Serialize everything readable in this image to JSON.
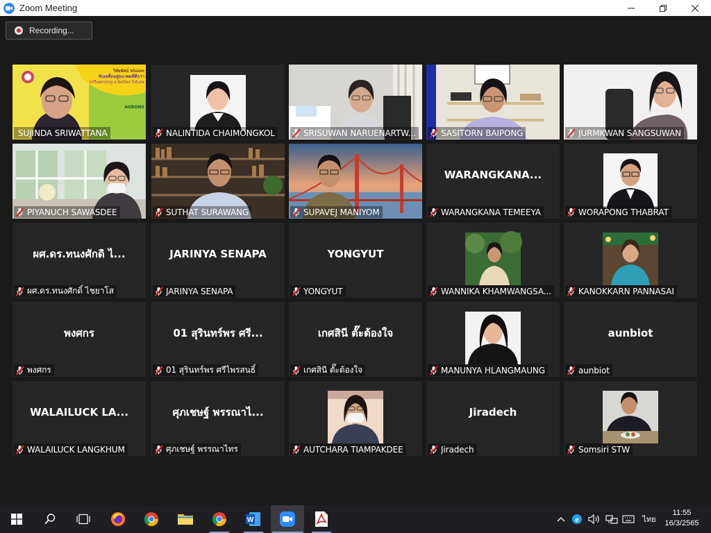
{
  "window": {
    "title": "Zoom Meeting"
  },
  "recording": {
    "label": "Recording..."
  },
  "participants": [
    {
      "name": "SUJINDA SRIWATTANA",
      "video": true,
      "active_speaker": true,
      "muted": false,
      "banner_line1": "วิสัยทัศน์ Vision",
      "banner_line2": "ขับเคลื่อนสู่อนาคตที่ดีกว่า",
      "banner_line3": "Influencing a better future",
      "banner_logo": "AGRONS"
    },
    {
      "name": "NALINTIDA CHAIMONGKOL",
      "video": true,
      "muted": true
    },
    {
      "name": "SRISUWAN NARUENARTW...",
      "video": true,
      "muted": true
    },
    {
      "name": "SASITORN BAIPONG",
      "video": true,
      "muted": true
    },
    {
      "name": "JURMKWAN SANGSUWAN",
      "video": true,
      "muted": true
    },
    {
      "name": "PIYANUCH SAWASDEE",
      "video": true,
      "muted": true
    },
    {
      "name": "SUTHAT SURAWANG",
      "video": true,
      "muted": true
    },
    {
      "name": "SUPAVEJ MANIYOM",
      "video": true,
      "muted": true
    },
    {
      "name": "WARANGKANA TEMEEYA",
      "video": false,
      "big": "WARANGKANA...",
      "muted": true
    },
    {
      "name": "WORAPONG THABRAT",
      "video": true,
      "muted": true
    },
    {
      "name": "ผศ.ดร.ทนงศักดิ์ ไชยาโส",
      "video": false,
      "big": "ผศ.ดร.ทนงศักดิ ไ...",
      "muted": true
    },
    {
      "name": "JARINYA SENAPA",
      "video": false,
      "big": "JARINYA SENAPA",
      "muted": true
    },
    {
      "name": "YONGYUT",
      "video": false,
      "big": "YONGYUT",
      "muted": true
    },
    {
      "name": "WANNIKA KHAMWANGSA...",
      "video": true,
      "muted": true
    },
    {
      "name": "KANOKKARN PANNASAI",
      "video": true,
      "muted": true
    },
    {
      "name": "พงศกร",
      "video": false,
      "big": "พงศกร",
      "muted": true
    },
    {
      "name": "01 สุรินทร์พร ศรีไพรสนธิ์",
      "video": false,
      "big": "01 สุรินทร์พร ศรี...",
      "muted": true
    },
    {
      "name": "เกศสินี ตั๊ะต้องใจ",
      "video": false,
      "big": "เกศสินี ตั๊ะต้องใจ",
      "muted": true
    },
    {
      "name": "MANUNYA HLANGMAUNG",
      "video": true,
      "muted": true
    },
    {
      "name": "aunbiot",
      "video": false,
      "big": "aunbiot",
      "muted": true
    },
    {
      "name": "WALAILUCK LANGKHUM",
      "video": false,
      "big": "WALAILUCK LA...",
      "muted": true
    },
    {
      "name": "ศุภเชษฐ์ พรรณาไทร",
      "video": false,
      "big": "ศุภเชษฐ์ พรรณาไ...",
      "muted": true
    },
    {
      "name": "AUTCHARA TIAMPAKDEE",
      "video": true,
      "muted": true
    },
    {
      "name": "Jiradech",
      "video": false,
      "big": "Jiradech",
      "muted": true
    },
    {
      "name": "Somsiri STW",
      "video": true,
      "muted": true
    }
  ],
  "taskbar": {
    "apps": [
      "start-icon",
      "search-icon",
      "task-view-icon",
      "firefox-icon",
      "chrome-icon",
      "file-explorer-icon",
      "chrome-icon",
      "word-icon",
      "zoom-icon",
      "acrobat-icon"
    ],
    "tray": {
      "language": "ไทย",
      "time": "11:55",
      "date": "16/3/2565"
    }
  },
  "colors": {
    "active_speaker_border": "#f5e60a",
    "muted_icon": "#e02828",
    "tile_bg": "#262626",
    "stage_bg": "#1a1a1a"
  }
}
